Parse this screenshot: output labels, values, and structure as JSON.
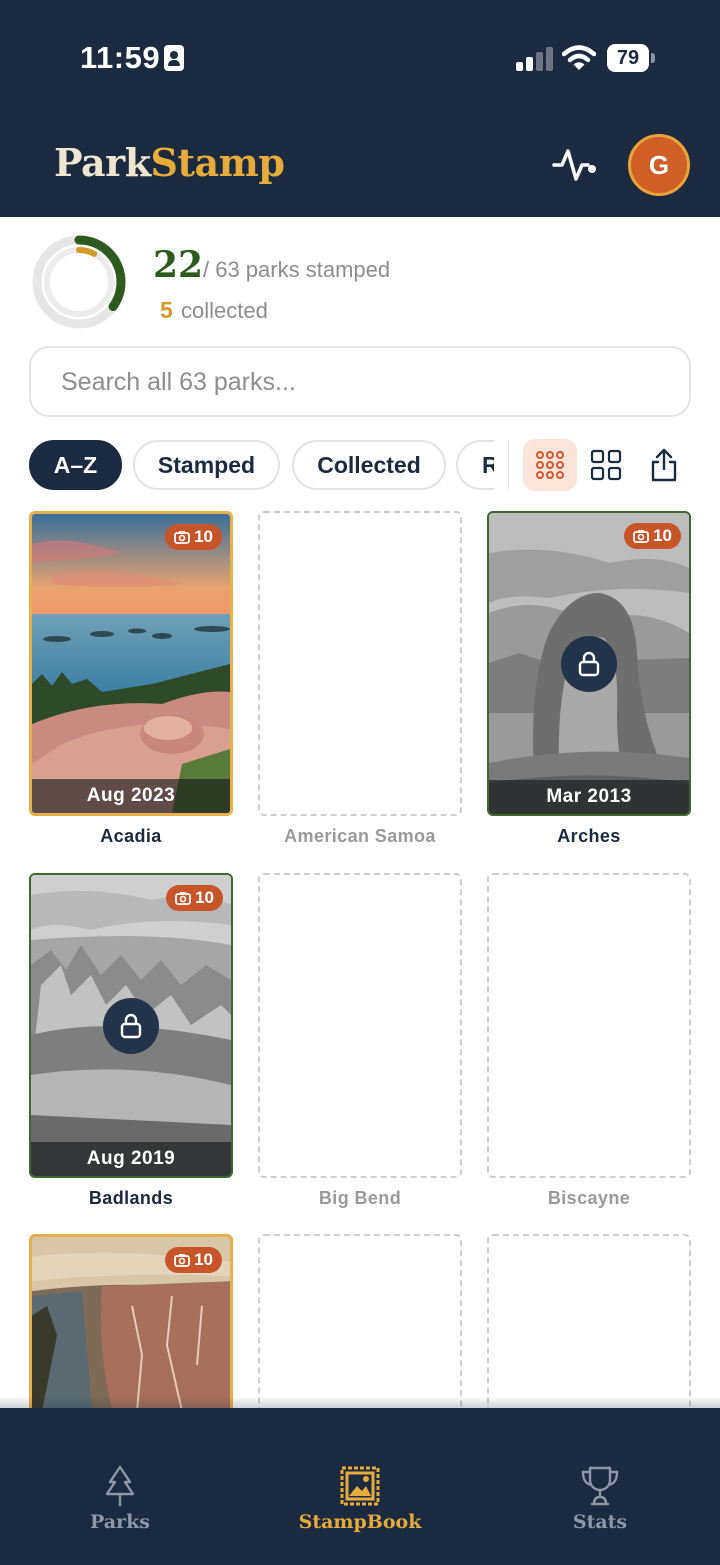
{
  "status_bar": {
    "time": "11:59",
    "battery": "79"
  },
  "header": {
    "logo_part1": "Park",
    "logo_part2": "Stamp",
    "avatar_initial": "G"
  },
  "progress": {
    "stamped": "22",
    "stamped_suffix": "/ 63 parks stamped",
    "collected": "5",
    "collected_suffix": "collected",
    "stamped_fraction": 0.349,
    "collected_fraction": 0.079
  },
  "search": {
    "placeholder": "Search all 63 parks..."
  },
  "filters": [
    {
      "label": "A–Z",
      "active": true
    },
    {
      "label": "Stamped",
      "active": false
    },
    {
      "label": "Collected",
      "active": false
    },
    {
      "label": "R",
      "active": false
    }
  ],
  "cards": [
    {
      "name": "Acadia",
      "photos": "10",
      "date": "Aug 2023"
    },
    {
      "name": "American Samoa"
    },
    {
      "name": "Arches",
      "photos": "10",
      "date": "Mar 2013"
    },
    {
      "name": "Badlands",
      "photos": "10",
      "date": "Aug 2019"
    },
    {
      "name": "Big Bend"
    },
    {
      "name": "Biscayne"
    },
    {
      "photos": "10"
    }
  ],
  "nav": [
    {
      "label": "Parks",
      "icon": "tree-icon"
    },
    {
      "label": "StampBook",
      "icon": "stamp-icon",
      "active": true
    },
    {
      "label": "Stats",
      "icon": "trophy-icon"
    }
  ],
  "colors": {
    "navy": "#1b2a3f",
    "gold": "#e5ac3c",
    "accent": "#c8542a",
    "green": "#2f5a1f"
  }
}
